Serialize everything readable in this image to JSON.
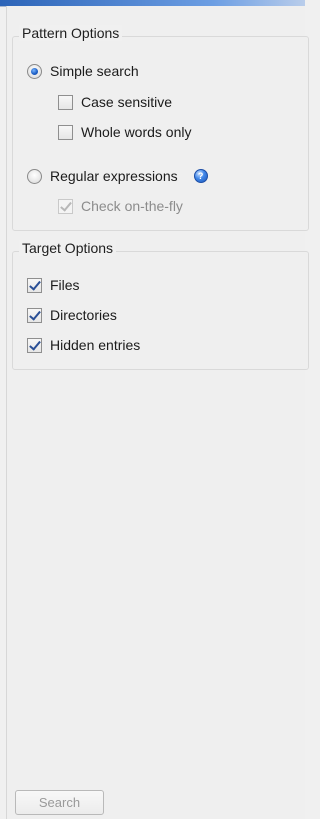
{
  "pattern_options": {
    "title": "Pattern Options",
    "simple_search": {
      "label": "Simple search",
      "selected": true
    },
    "case_sensitive": {
      "label": "Case sensitive",
      "checked": false
    },
    "whole_words_only": {
      "label": "Whole words only",
      "checked": false
    },
    "regular_expressions": {
      "label": "Regular expressions",
      "selected": false,
      "help_icon": "help-icon"
    },
    "check_on_the_fly": {
      "label": "Check on-the-fly",
      "checked": true,
      "enabled": false
    }
  },
  "target_options": {
    "title": "Target Options",
    "files": {
      "label": "Files",
      "checked": true
    },
    "directories": {
      "label": "Directories",
      "checked": true
    },
    "hidden_entries": {
      "label": "Hidden entries",
      "checked": true
    }
  },
  "footer": {
    "search_label": "Search",
    "search_enabled": false
  },
  "colors": {
    "accent": "#2c64b8",
    "disabled_text": "#8c8c8c"
  }
}
